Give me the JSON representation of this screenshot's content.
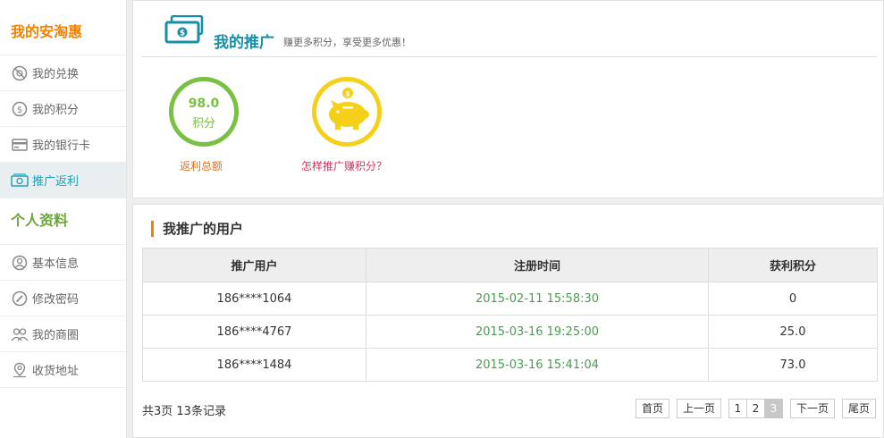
{
  "sidebar": {
    "section1_title": "我的安淘惠",
    "items1": [
      {
        "label": "我的兑换",
        "icon": "exchange-icon"
      },
      {
        "label": "我的积分",
        "icon": "coin-icon"
      },
      {
        "label": "我的银行卡",
        "icon": "bank-card-icon"
      },
      {
        "label": "推广返利",
        "icon": "money-icon",
        "active": true
      }
    ],
    "section2_title": "个人资料",
    "items2": [
      {
        "label": "基本信息",
        "icon": "user-icon"
      },
      {
        "label": "修改密码",
        "icon": "pencil-icon"
      },
      {
        "label": "我的商圈",
        "icon": "group-icon"
      },
      {
        "label": "收货地址",
        "icon": "map-pin-icon"
      }
    ]
  },
  "header": {
    "title": "我的推广",
    "subtitle": "赚更多积分，享受更多优惠！"
  },
  "stats": {
    "value": "98.0",
    "unit": "积分",
    "label": "返利总额",
    "how_link": "怎样推广赚积分？"
  },
  "users_section": {
    "title": "我推广的用户",
    "columns": [
      "推广用户",
      "注册时间",
      "获利积分"
    ],
    "rows": [
      {
        "user": "186****1064",
        "time": "2015-02-11 15:58:30",
        "points": "0"
      },
      {
        "user": "186****4767",
        "time": "2015-03-16 19:25:00",
        "points": "25.0"
      },
      {
        "user": "186****1484",
        "time": "2015-03-16 15:41:04",
        "points": "73.0"
      }
    ],
    "summary": "共3页 13条记录"
  },
  "pager": {
    "first": "首页",
    "prev": "上一页",
    "pages": [
      "1",
      "2",
      "3"
    ],
    "current": "3",
    "next": "下一页",
    "last": "尾页"
  },
  "colors": {
    "accent_orange": "#f08200",
    "accent_green": "#7ac143",
    "accent_teal": "#178fa6",
    "accent_yellow": "#f6cf19"
  }
}
